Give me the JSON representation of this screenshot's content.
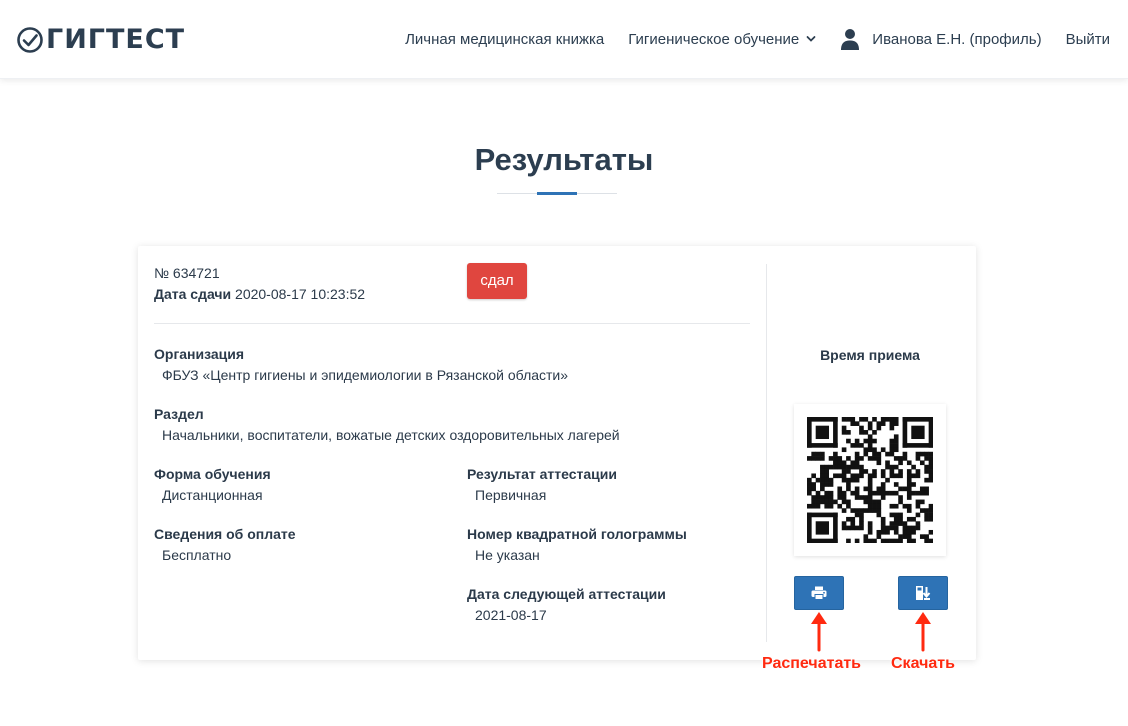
{
  "header": {
    "logo_text": "ГИГТЕСТ",
    "nav": {
      "medbook": "Личная медицинская книжка",
      "training": "Гигиеническое обучение",
      "profile": "Иванова Е.Н. (профиль)",
      "logout": "Выйти"
    }
  },
  "page": {
    "title": "Результаты"
  },
  "result": {
    "number": "№ 634721",
    "date_label": "Дата сдачи",
    "date_value": "2020-08-17 10:23:52",
    "status": "сдал",
    "org_label": "Организация",
    "org_value": "ФБУЗ «Центр гигиены и эпидемиологии в Рязанской области»",
    "section_label": "Раздел",
    "section_value": "Начальники, воспитатели, вожатые детских оздоровительных лагерей",
    "form_label": "Форма обучения",
    "form_value": "Дистанционная",
    "payment_label": "Сведения об оплате",
    "payment_value": "Бесплатно",
    "att_result_label": "Результат аттестации",
    "att_result_value": "Первичная",
    "hologram_label": "Номер квадратной голограммы",
    "hologram_value": "Не указан",
    "next_att_label": "Дата следующей аттестации",
    "next_att_value": "2021-08-17"
  },
  "side": {
    "time_label": "Время приема",
    "print_icon": "printer-icon",
    "download_icon": "download-icon"
  },
  "annotations": {
    "print": "Распечатать",
    "download": "Скачать"
  },
  "colors": {
    "accent": "#2e73b6",
    "status_fail_red": "#e0463f",
    "annotation": "#ff2a10",
    "text": "#2b3a4a"
  }
}
